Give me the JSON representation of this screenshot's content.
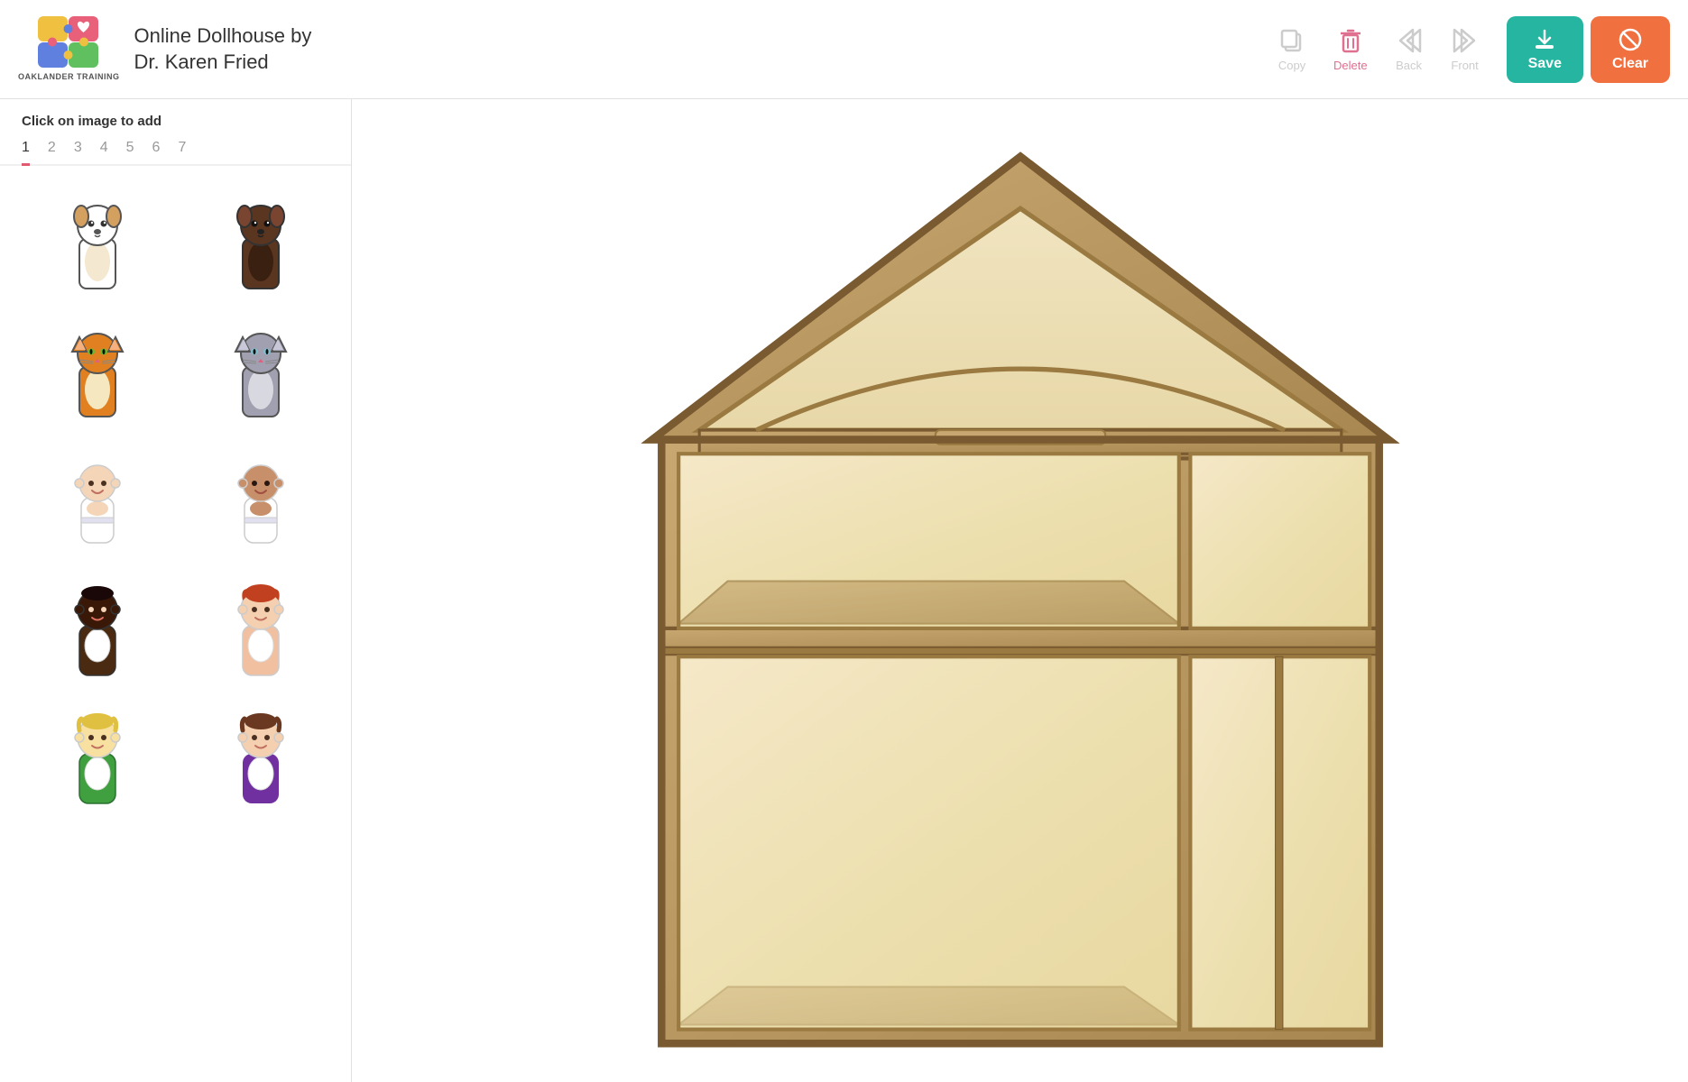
{
  "header": {
    "logo_text": "OAKLANDER\nTRAINING",
    "app_title_line1": "Online Dollhouse by",
    "app_title_line2": "Dr. Karen Fried",
    "toolbar": {
      "copy_label": "Copy",
      "delete_label": "Delete",
      "back_label": "Back",
      "front_label": "Front",
      "save_label": "Save",
      "clear_label": "Clear"
    }
  },
  "sidebar": {
    "instruction_bold": "Click",
    "instruction_rest": " on image to add",
    "tabs": [
      "1",
      "2",
      "3",
      "4",
      "5",
      "6",
      "7"
    ],
    "active_tab": "1"
  },
  "colors": {
    "save_bg": "#26b5a0",
    "clear_bg": "#f07040",
    "tab_active_border": "#e05a70",
    "toolbar_inactive": "#cccccc"
  }
}
